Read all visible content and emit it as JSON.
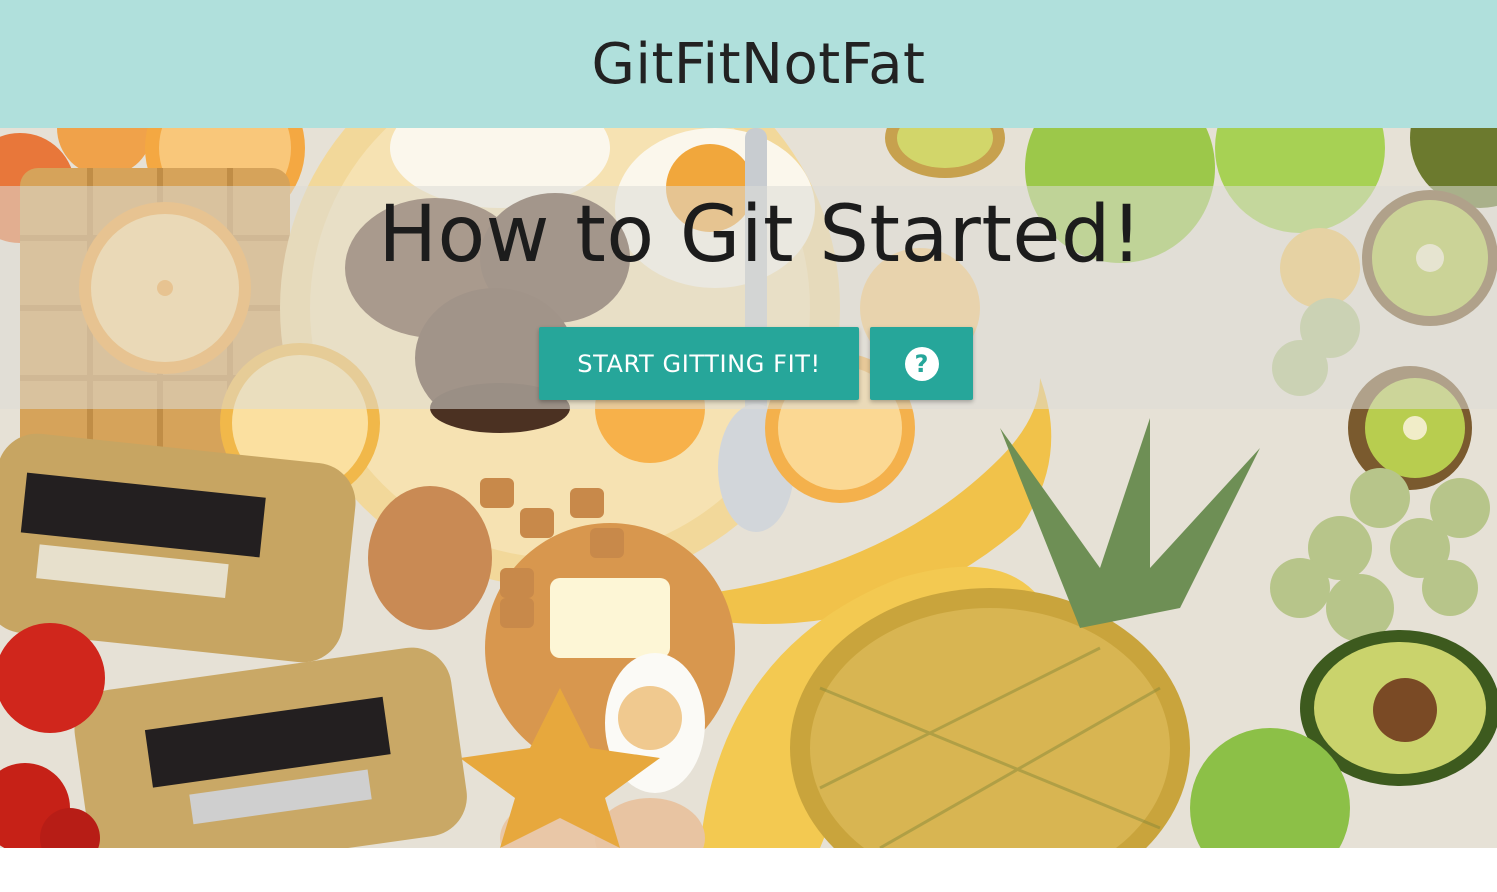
{
  "header": {
    "title": "GitFitNotFat"
  },
  "hero": {
    "heading": "How to Git Started!",
    "start_button_label": "START GITTING FIT!",
    "help_button_icon": "?",
    "background": "food-flatlay-photo"
  },
  "colors": {
    "header_bg": "#b0e0dc",
    "button_bg": "#26a69a",
    "button_text": "#ffffff"
  },
  "icons": {
    "help": "question-circle-icon"
  }
}
